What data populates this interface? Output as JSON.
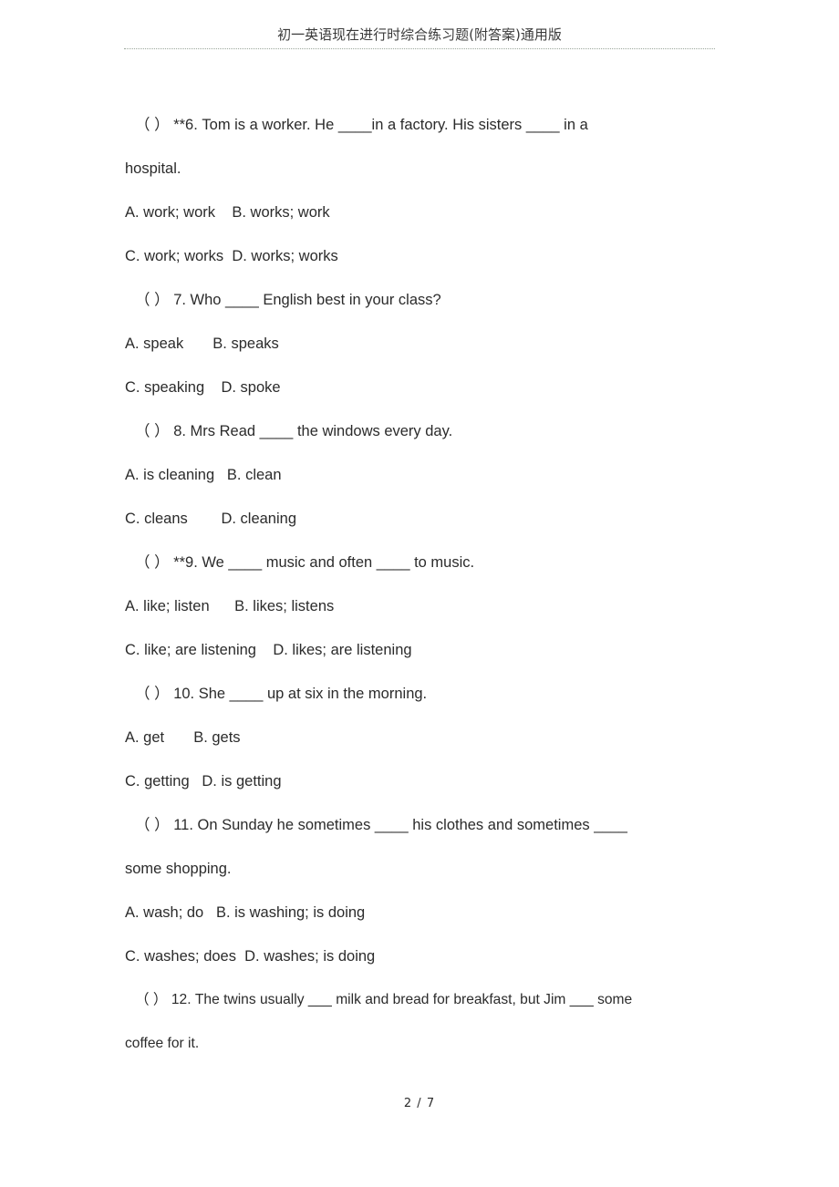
{
  "header": {
    "title": "初一英语现在进行时综合练习题(附答案)通用版"
  },
  "footer": {
    "page_label": "2 / 7"
  },
  "questions": [
    {
      "marker": "（    ）",
      "number": "**6.",
      "stem_line1": "Tom is a worker. He ____in a factory. His sisters ____ in a",
      "stem_line2": "hospital.",
      "options_row1": "A. work; work    B. works; work",
      "options_row2": "C. work; works  D. works; works"
    },
    {
      "marker": "（    ）",
      "number": "7.",
      "stem_line1": "Who ____ English best in your class?",
      "options_row1": "A. speak       B. speaks",
      "options_row2": "C. speaking    D. spoke"
    },
    {
      "marker": "（    ）",
      "number": "8.",
      "stem_line1": "Mrs Read ____ the windows every day.",
      "options_row1": "A. is cleaning   B. clean",
      "options_row2": "C. cleans        D. cleaning"
    },
    {
      "marker": "（    ）",
      "number": "**9.",
      "stem_line1": "We ____ music and often ____ to music.",
      "options_row1": "A. like; listen      B. likes; listens",
      "options_row2": "C. like; are listening    D. likes; are listening"
    },
    {
      "marker": "（    ）",
      "number": "10.",
      "stem_line1": "She ____ up at six in the morning.",
      "options_row1": "A. get       B. gets",
      "options_row2": "C. getting   D. is getting"
    },
    {
      "marker": "（    ）",
      "number": "11.",
      "stem_line1": "On Sunday he sometimes ____ his clothes and sometimes ____",
      "stem_line2": "some shopping.",
      "options_row1": "A. wash; do   B. is washing; is doing",
      "options_row2": "C. washes; does  D. washes; is doing"
    },
    {
      "marker": "（    ）",
      "number": "12.",
      "stem_line1": "The twins usually ___ milk and bread for breakfast, but Jim ___ some",
      "stem_line2": "coffee for it."
    }
  ]
}
